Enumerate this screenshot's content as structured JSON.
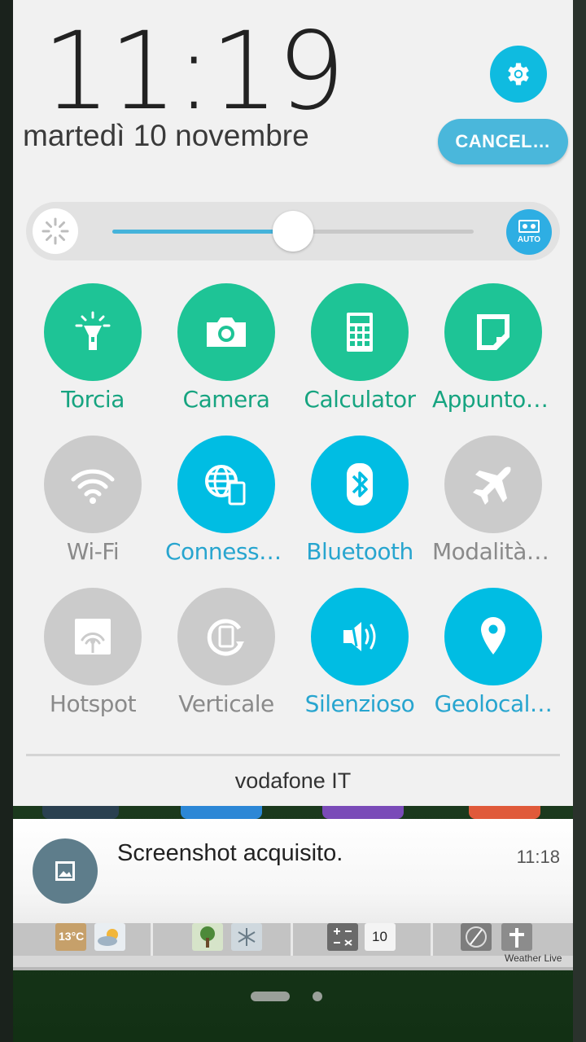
{
  "status": {
    "time": "11:19",
    "date": "martedì 10 novembre"
  },
  "header": {
    "cancel_label": "CANCEL…"
  },
  "brightness": {
    "level": 0.5,
    "auto_label": "AUTO"
  },
  "tiles": [
    {
      "label": "Torcia",
      "icon": "flashlight-icon",
      "state": "app"
    },
    {
      "label": "Camera",
      "icon": "camera-icon",
      "state": "app"
    },
    {
      "label": "Calculator",
      "icon": "calculator-icon",
      "state": "app"
    },
    {
      "label": "Appunto …",
      "icon": "note-icon",
      "state": "app"
    },
    {
      "label": "Wi-Fi",
      "icon": "wifi-icon",
      "state": "off"
    },
    {
      "label": "Connessio…",
      "icon": "mobile-data-icon",
      "state": "on"
    },
    {
      "label": "Bluetooth",
      "icon": "bluetooth-icon",
      "state": "on"
    },
    {
      "label": "Modalità a…",
      "icon": "airplane-icon",
      "state": "off"
    },
    {
      "label": "Hotspot",
      "icon": "hotspot-icon",
      "state": "off"
    },
    {
      "label": "Verticale",
      "icon": "rotation-lock-icon",
      "state": "off"
    },
    {
      "label": "Silenzioso",
      "icon": "vibrate-icon",
      "state": "on"
    },
    {
      "label": "Geolocal…",
      "icon": "location-icon",
      "state": "on"
    }
  ],
  "carrier": "vodafone IT",
  "notification": {
    "title": "Screenshot acquisito.",
    "time": "11:18"
  },
  "widgets": {
    "temperature": "13°C",
    "count": "10",
    "weather_label": "Weather Live"
  },
  "colors": {
    "accent_blue": "#00bde3",
    "app_green": "#1ec496",
    "off_grey": "#cbcbcb"
  }
}
